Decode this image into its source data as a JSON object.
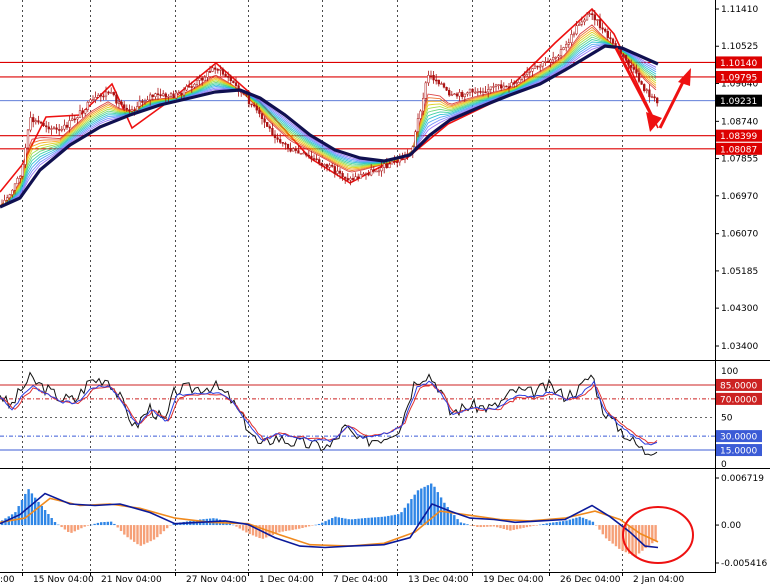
{
  "colors": {
    "background": "#ffffff",
    "grid": "#000000",
    "candle": "#aa1111",
    "ma_thick": "#101050",
    "level_line": "#dd0000",
    "current_price_line": "#4a6cd4",
    "annotation": "#ee1111",
    "histogram_up": "#2f86e6",
    "histogram_down": "#f6a078",
    "signal_line": "#f08a1e",
    "macd_line": "#0b1a9a",
    "osc_level_red": "#cc2222",
    "osc_level_blue": "#3b5bd6"
  },
  "price_panel": {
    "axis_labels": [
      "1.11410",
      "1.10525",
      "1.09640",
      "1.08740",
      "1.07855",
      "1.06970",
      "1.06070",
      "1.05185",
      "1.04300",
      "1.03400"
    ],
    "axis_values": [
      1.1141,
      1.10525,
      1.0964,
      1.0874,
      1.07855,
      1.0697,
      1.0607,
      1.05185,
      1.043,
      1.034
    ],
    "levels": [
      {
        "label": "1.10140",
        "value": 1.1014
      },
      {
        "label": "1.09795",
        "value": 1.09795
      },
      {
        "label": "1.08399",
        "value": 1.08399
      },
      {
        "label": "1.08087",
        "value": 1.08087
      }
    ],
    "current_price": {
      "label": "1.09231",
      "value": 1.09231
    }
  },
  "oscillator_panel": {
    "axis_labels": [
      "100",
      "50",
      "0"
    ],
    "levels": [
      {
        "label": "85.0000",
        "value": 85
      },
      {
        "label": "70.0000",
        "value": 70
      },
      {
        "label": "30.0000",
        "value": 30
      },
      {
        "label": "15.0000",
        "value": 15
      }
    ]
  },
  "macd_panel": {
    "axis_labels": [
      "0.006719",
      "0.00",
      "-0.005416"
    ]
  },
  "time_axis": [
    "15 Nov 04:00",
    "21 Nov 04:00",
    "27 Nov 04:00",
    "1 Dec 04:00",
    "7 Dec 04:00",
    "13 Dec 04:00",
    "19 Dec 04:00",
    "26 Dec 04:00",
    "2 Jan 04:00"
  ],
  "time_axis_left_partial": ":00"
}
